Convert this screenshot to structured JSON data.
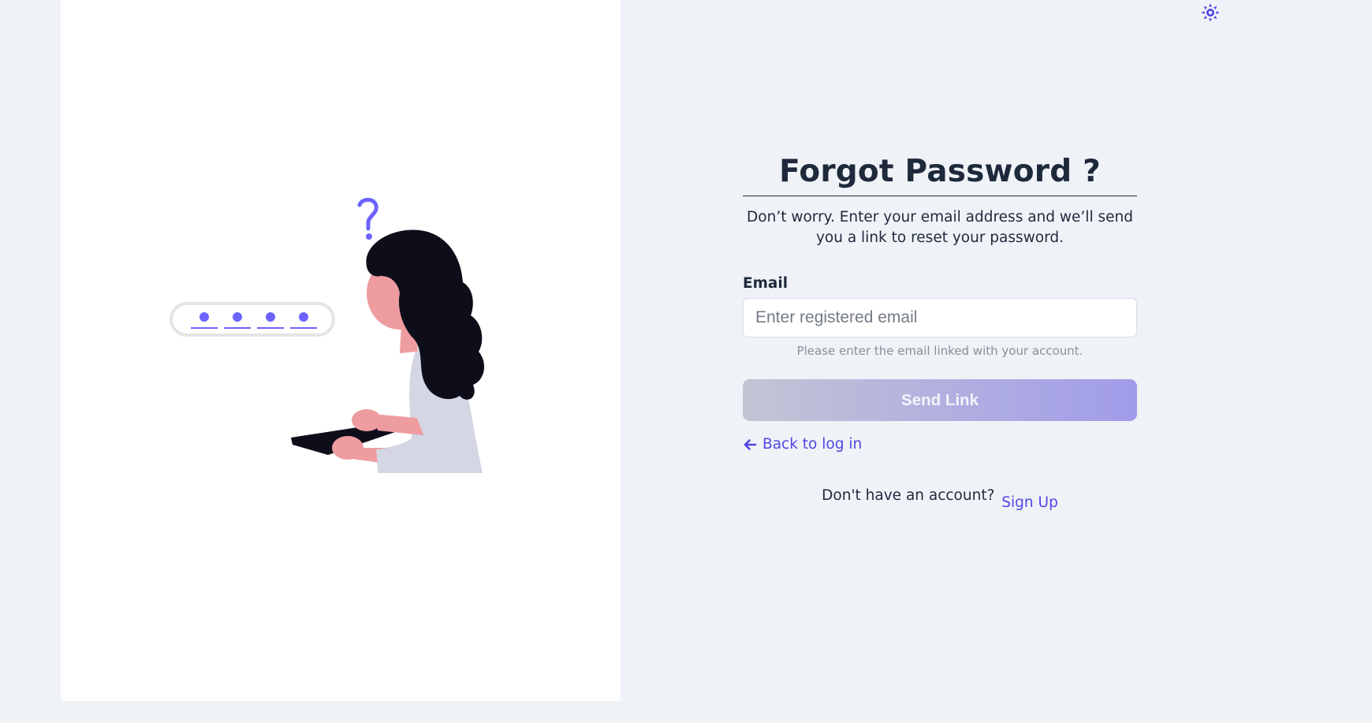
{
  "theme_toggle": {
    "icon": "sun-icon",
    "accent": "#4f46e5"
  },
  "illustration": {
    "pin_mask": "••••",
    "question_mark": "?"
  },
  "form": {
    "title": "Forgot Password ?",
    "subtitle": "Don’t worry. Enter your email address and we’ll send you a link to reset your password.",
    "email_label": "Email",
    "email_placeholder": "Enter registered email",
    "email_value": "",
    "helper_text": "Please enter the email linked with your account.",
    "send_button_label": "Send Link",
    "back_link_label": "Back to log in",
    "back_icon": "arrow-left-icon",
    "signup_prompt": "Don't have an account?",
    "signup_link_label": "Sign Up"
  },
  "colors": {
    "accent": "#4f46e5",
    "illustration_accent": "#6c63ff",
    "page_background": "#eff2f7",
    "panel_background": "#ffffff"
  }
}
